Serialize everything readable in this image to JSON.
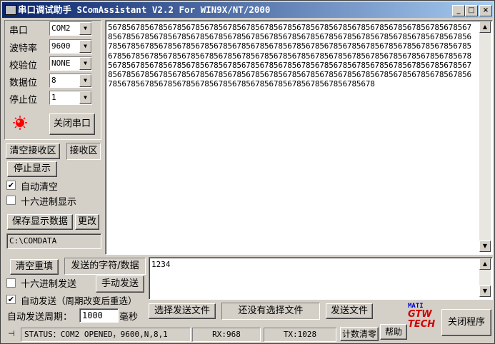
{
  "title": "串口调试助手 SComAssistant V2.2 For WIN9X/NT/2000",
  "title_buttons": {
    "minimize": "_",
    "maximize": "□",
    "close": "×"
  },
  "settings": [
    {
      "label": "串口",
      "value": "COM2"
    },
    {
      "label": "波特率",
      "value": "9600"
    },
    {
      "label": "校验位",
      "value": "NONE"
    },
    {
      "label": "数据位",
      "value": "8"
    },
    {
      "label": "停止位",
      "value": "1"
    }
  ],
  "close_port_label": "关闭串口",
  "clear_receive_label": "清空接收区",
  "receive_area_label": "接收区",
  "stop_display_label": "停止显示",
  "auto_clear_label": "自动清空",
  "hex_display_label": "十六进制显示",
  "save_display_label": "保存显示数据",
  "change_label": "更改",
  "save_path": "C:\\COMDATA",
  "receive_text": "5678567856785678567856785678567856785678567856785678567856785678567856785678567856785678567856785678567856785678567856785678567856785678567856785678567856785678567856785678567856785678567856785678567856785678567856785678567856785678567856785678567856785678567856785678567856785678567856785678567856785678567856785678567856785678567856785678567856785678567856785678567856785678567856785678567856785678567856785678567856785678567856785678567856785678567856785678567856785678567856785678567856785678567856785678567856785678567856785678",
  "send": {
    "clear_resend_label": "清空重填",
    "send_chars_label": "发送的字符/数据",
    "hex_send_label": "十六进制发送",
    "manual_send_label": "手动发送",
    "auto_send_label": "自动发送（周期改变后重选）",
    "period_label": "自动发送周期：",
    "period_value": "1000",
    "period_unit": "毫秒",
    "send_text": "1234",
    "select_file_label": "选择发送文件",
    "no_file_label": "还没有选择文件",
    "send_file_label": "发送文件"
  },
  "status": {
    "status_text": "STATUS：COM2 OPENED，9600,N,8,1",
    "rx": "RX:968",
    "tx": "TX:1028",
    "count_clear_label": "计数清零",
    "help_label": "帮助",
    "close_program_label": "关闭程序"
  },
  "logo": {
    "top": "MATI",
    "mid": "GTW",
    "bottom": "TECH"
  },
  "colors": {
    "title_start": "#0a246a",
    "title_end": "#a6caf0",
    "indicator": "#ff0000",
    "face": "#d4d0c8"
  }
}
